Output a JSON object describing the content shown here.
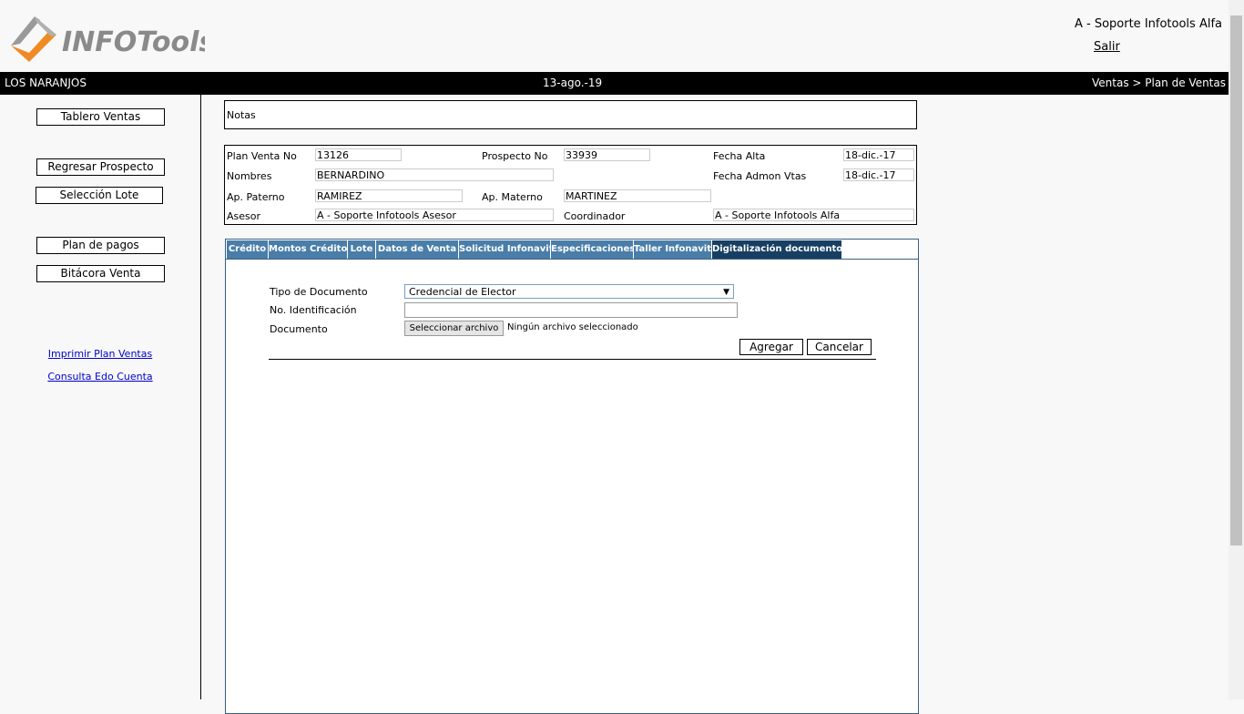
{
  "header": {
    "logo_text": "INFOTools",
    "user_name": "A - Soporte Infotools Alfa",
    "logout_label": "Salir"
  },
  "topbar": {
    "company": "LOS NARANJOS",
    "date": "13-ago.-19",
    "breadcrumb": "Ventas > Plan de Ventas"
  },
  "sidebar": {
    "buttons": [
      "Tablero Ventas",
      "Regresar Prospecto",
      "Selección Lote",
      "Plan de pagos",
      "Bitácora Venta"
    ],
    "links": [
      "Imprimir Plan Ventas",
      "Consulta Edo Cuenta"
    ]
  },
  "notes": {
    "label": "Notas"
  },
  "info": {
    "plan_venta_label": "Plan Venta No",
    "plan_venta_value": "13126",
    "prospecto_label": "Prospecto No",
    "prospecto_value": "33939",
    "fecha_alta_label": "Fecha Alta",
    "fecha_alta_value": "18-dic.-17",
    "nombres_label": "Nombres",
    "nombres_value": "BERNARDINO",
    "fecha_admon_label": "Fecha Admon Vtas",
    "fecha_admon_value": "18-dic.-17",
    "ap_paterno_label": "Ap. Paterno",
    "ap_paterno_value": "RAMIREZ",
    "ap_materno_label": "Ap. Materno",
    "ap_materno_value": "MARTINEZ",
    "asesor_label": "Asesor",
    "asesor_value": "A - Soporte Infotools Asesor",
    "coordinador_label": "Coordinador",
    "coordinador_value": "A - Soporte Infotools Alfa"
  },
  "tabs": [
    "Crédito",
    "Montos Crédito",
    "Lote",
    "Datos de Venta",
    "Solicitud Infonavit",
    "Especificaciones",
    "Taller Infonavit",
    "Digitalización documentos"
  ],
  "form": {
    "tipo_documento_label": "Tipo de Documento",
    "tipo_documento_value": "Credencial de Elector",
    "no_identificacion_label": "No. Identificación",
    "no_identificacion_value": "",
    "documento_label": "Documento",
    "file_button_label": "Seleccionar archivo",
    "file_status": "Ningún archivo seleccionado",
    "agregar_label": "Agregar",
    "cancelar_label": "Cancelar"
  },
  "colors": {
    "tab": "#4a7ea9",
    "tab_active": "#173f63",
    "logo_orange": "#f08a24",
    "logo_gray": "#8a8a8a"
  }
}
